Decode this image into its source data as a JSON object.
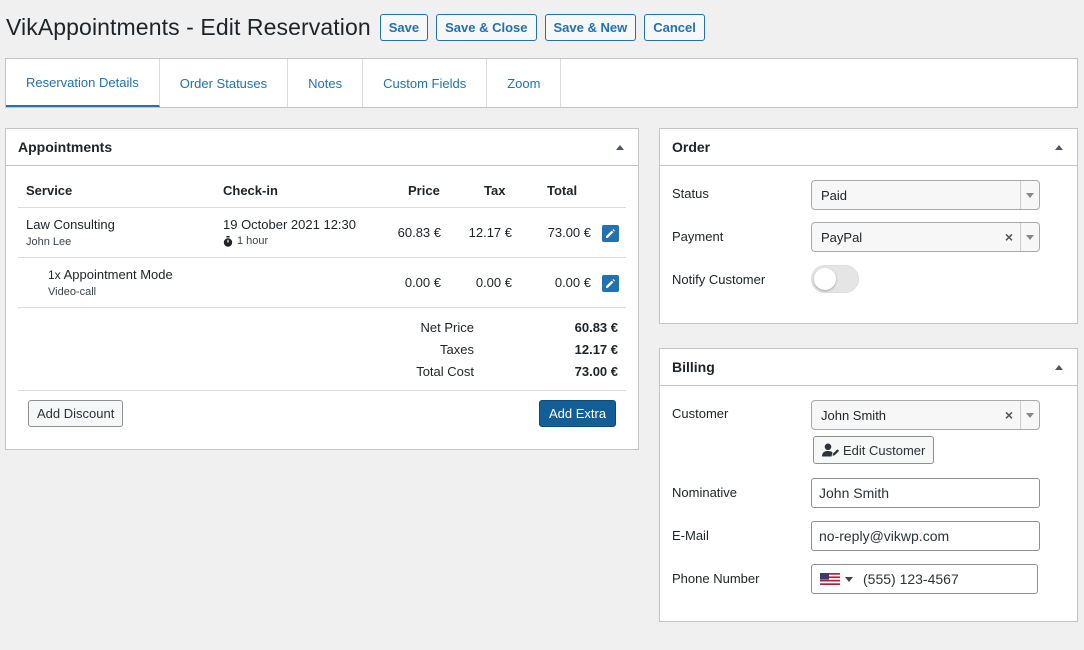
{
  "header": {
    "title": "VikAppointments - Edit Reservation",
    "buttons": {
      "save": "Save",
      "save_close": "Save & Close",
      "save_new": "Save & New",
      "cancel": "Cancel"
    }
  },
  "tabs": [
    {
      "label": "Reservation Details",
      "active": true
    },
    {
      "label": "Order Statuses"
    },
    {
      "label": "Notes"
    },
    {
      "label": "Custom Fields"
    },
    {
      "label": "Zoom"
    }
  ],
  "appointments": {
    "title": "Appointments",
    "columns": {
      "service": "Service",
      "checkin": "Check-in",
      "price": "Price",
      "tax": "Tax",
      "total": "Total"
    },
    "rows": [
      {
        "service": "Law Consulting",
        "employee": "John Lee",
        "checkin": "19 October 2021 12:30",
        "duration": "1 hour",
        "price": "60.83 €",
        "tax": "12.17 €",
        "total": "73.00 €"
      },
      {
        "qty": "1x",
        "service": "Appointment Mode",
        "option": "Video-call",
        "price": "0.00 €",
        "tax": "0.00 €",
        "total": "0.00 €"
      }
    ],
    "summary": {
      "net_label": "Net Price",
      "net_value": "60.83 €",
      "taxes_label": "Taxes",
      "taxes_value": "12.17 €",
      "total_label": "Total Cost",
      "total_value": "73.00 €"
    },
    "add_discount": "Add Discount",
    "add_extra": "Add Extra"
  },
  "order": {
    "title": "Order",
    "status_label": "Status",
    "status_value": "Paid",
    "payment_label": "Payment",
    "payment_value": "PayPal",
    "notify_label": "Notify Customer",
    "notify_on": false
  },
  "billing": {
    "title": "Billing",
    "customer_label": "Customer",
    "customer_value": "John Smith",
    "edit_customer": "Edit Customer",
    "nominative_label": "Nominative",
    "nominative_value": "John Smith",
    "email_label": "E-Mail",
    "email_value": "no-reply@vikwp.com",
    "phone_label": "Phone Number",
    "phone_value": "(555) 123-4567"
  },
  "colors": {
    "accent": "#2271b1",
    "primary_button": "#135e96"
  }
}
